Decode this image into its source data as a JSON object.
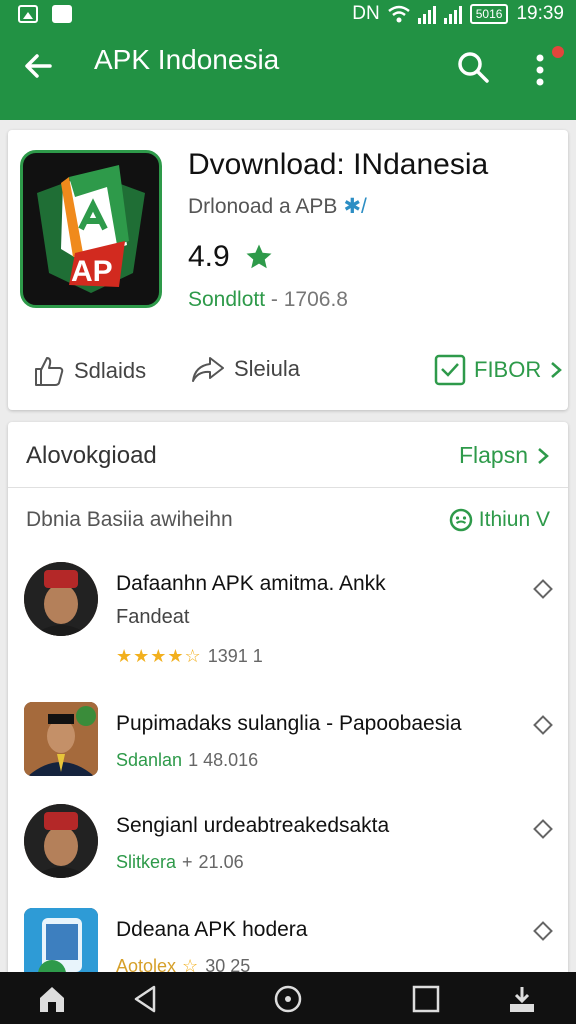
{
  "status": {
    "battery": "5016",
    "time": "19:39",
    "network": "DN"
  },
  "header": {
    "title": "APK Indonesia"
  },
  "app": {
    "name": "Dvownload: INdanesia",
    "developer": "Drlonoad a APB",
    "developer_suffix": "✱/",
    "rating": "4.9",
    "meta_green": "Sondlott",
    "meta_gray": " - 1706.8",
    "actions": {
      "like": "Sdlaids",
      "share": "Sleiula",
      "follow": "FIBOR"
    }
  },
  "section": {
    "title": "Alovokgioad",
    "link": "Flapsn",
    "filter_label": "Dbnia Basiia awiheihn",
    "filter_select": "Ithiun V"
  },
  "items": [
    {
      "title": "Dafaanhn APK amitma. Ankk",
      "subtitle": "Fandeat",
      "stars": "★★★★☆",
      "meta": "1391 1"
    },
    {
      "title": "Pupimadaks sulanglia - Papoobaesia",
      "meta_green": "Sdanlan",
      "meta": "1 48.016"
    },
    {
      "title": "Sengianl urdeabtreakedsakta",
      "meta_green": "Slitkera",
      "meta_plus": "+",
      "meta": "21.06"
    },
    {
      "title": "Ddeana APK hodera",
      "meta_gold": "Aotolex",
      "meta_star": "☆",
      "meta": "30 25"
    }
  ],
  "colors": {
    "brand": "#229244",
    "accent": "#2e9a4a",
    "star": "#f2b01e"
  }
}
